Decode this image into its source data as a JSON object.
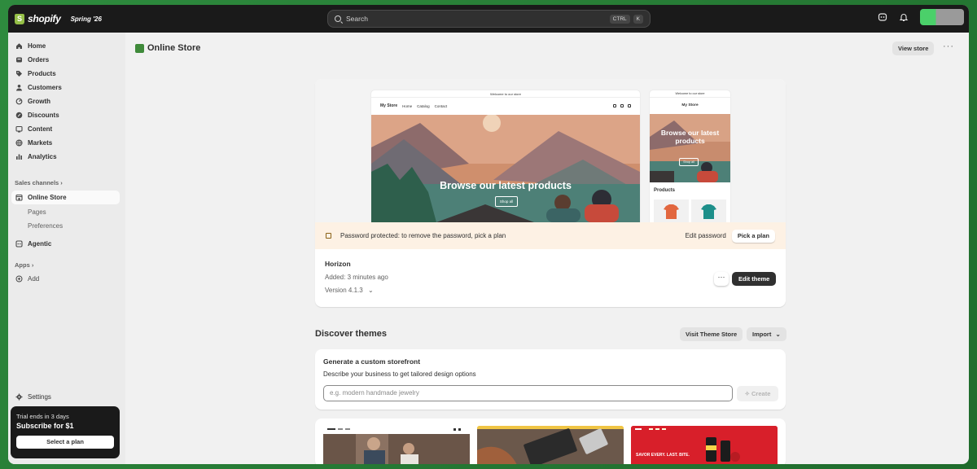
{
  "topbar": {
    "brand": "shopify",
    "edition": "Spring '26",
    "search_placeholder": "Search",
    "shortcut_keys": [
      "CTRL",
      "K"
    ]
  },
  "sidebar": {
    "items": [
      {
        "label": "Home",
        "icon": "home-icon"
      },
      {
        "label": "Orders",
        "icon": "orders-icon"
      },
      {
        "label": "Products",
        "icon": "tag-icon"
      },
      {
        "label": "Customers",
        "icon": "person-icon"
      },
      {
        "label": "Growth",
        "icon": "growth-icon"
      },
      {
        "label": "Discounts",
        "icon": "discount-icon"
      },
      {
        "label": "Content",
        "icon": "content-icon"
      },
      {
        "label": "Markets",
        "icon": "globe-icon"
      },
      {
        "label": "Analytics",
        "icon": "chart-icon"
      }
    ],
    "sales_channels_label": "Sales channels",
    "online_store_label": "Online Store",
    "sub_items": [
      "Pages",
      "Preferences"
    ],
    "agentic_label": "Agentic",
    "apps_label": "Apps",
    "add_label": "Add",
    "settings_label": "Settings",
    "trial": {
      "line1": "Trial ends in 3 days",
      "line2": "Subscribe for $1",
      "button": "Select a plan"
    }
  },
  "main": {
    "title": "Online Store",
    "view_store": "View store",
    "preview": {
      "announcement": "Welcome to our store",
      "store_name": "My Store",
      "nav_links": [
        "Home",
        "Catalog",
        "Contact"
      ],
      "hero_heading": "Browse our latest products",
      "hero_button": "Shop all",
      "mobile_heading": "Browse our latest products",
      "products_label": "Products"
    },
    "banner": {
      "text": "Password protected: to remove the password, pick a plan",
      "edit_password": "Edit password",
      "pick_plan": "Pick a plan"
    },
    "theme": {
      "name": "Horizon",
      "added": "Added: 3 minutes ago",
      "version": "Version 4.1.3",
      "edit_button": "Edit theme"
    },
    "discover": {
      "title": "Discover themes",
      "visit_store": "Visit Theme Store",
      "import": "Import"
    },
    "generate": {
      "title": "Generate a custom storefront",
      "subtitle": "Describe your business to get tailored design options",
      "placeholder": "e.g. modern handmade jewelry",
      "create": "Create"
    },
    "thumbnails": [
      {
        "caption": ""
      },
      {
        "caption": ""
      },
      {
        "caption": "SAVOR EVERY. LAST. BITE."
      }
    ]
  }
}
